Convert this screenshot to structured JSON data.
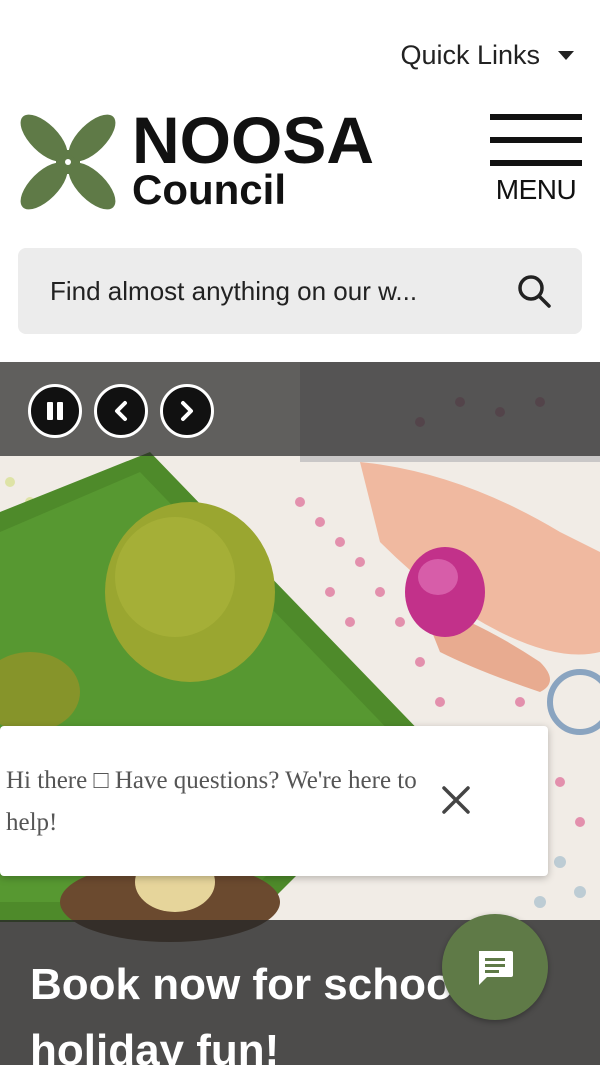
{
  "header": {
    "quick_links_label": "Quick Links",
    "logo_line1": "NOOSA",
    "logo_line2": "Council",
    "menu_label": "MENU"
  },
  "search": {
    "placeholder": "Find almost anything on our w..."
  },
  "hero": {
    "title": "Book now for school holiday fun!",
    "controls": [
      "pause-icon",
      "chevron-left-icon",
      "chevron-right-icon"
    ]
  },
  "chat": {
    "message": "Hi there □ Have questions? We're here to help!",
    "close_icon": "close-icon",
    "fab_icon": "chat-icon"
  },
  "colors": {
    "brand_green": "#5f7a47",
    "text_dark": "#111111",
    "search_bg": "#ececec"
  }
}
